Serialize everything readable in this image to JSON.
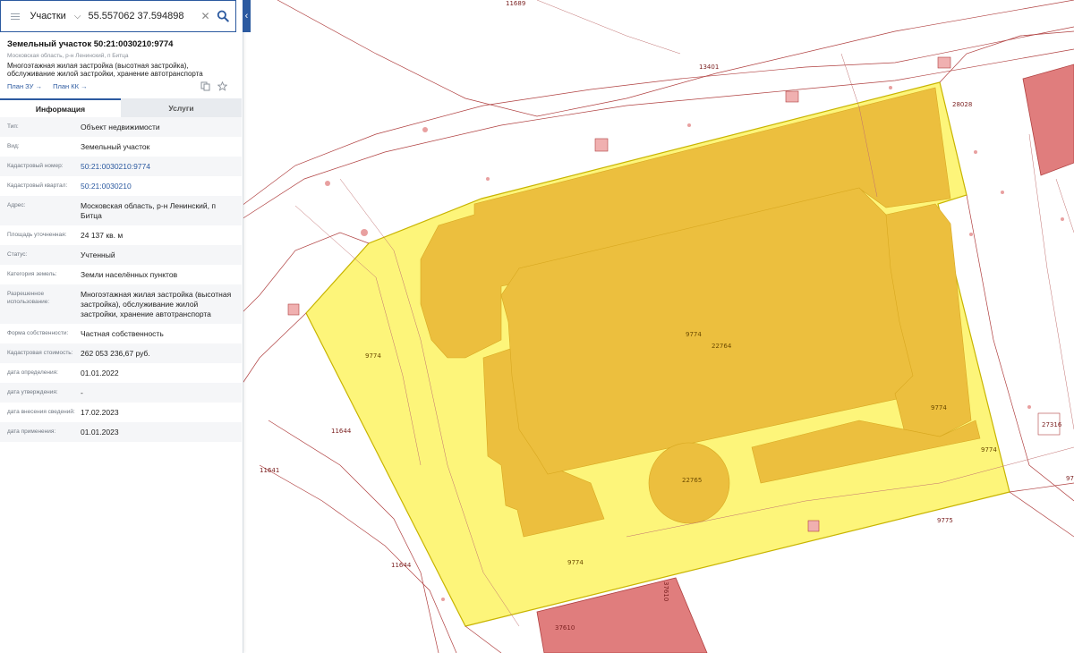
{
  "search": {
    "layer": "Участки",
    "value": "55.557062 37.594898"
  },
  "parcel": {
    "title": "Земельный участок 50:21:0030210:9774",
    "address_short": "Московская область, р-н Ленинский, п Битца",
    "description": "Многоэтажная жилая застройка (высотная застройка), обслуживание жилой застройки, хранение автотранспорта",
    "links": [
      "План ЗУ →",
      "План КК →"
    ]
  },
  "tabs": [
    "Информация",
    "Услуги"
  ],
  "rows": [
    {
      "label": "Тип:",
      "value": "Объект недвижимости"
    },
    {
      "label": "Вид:",
      "value": "Земельный участок"
    },
    {
      "label": "Кадастровый номер:",
      "value": "50:21:0030210:9774"
    },
    {
      "label": "Кадастровый квартал:",
      "value": "50:21:0030210"
    },
    {
      "label": "Адрес:",
      "value": "Московская область, р-н Ленинский, п Битца"
    },
    {
      "label": "Площадь уточненная:",
      "value": "24 137 кв. м"
    },
    {
      "label": "Статус:",
      "value": "Учтенный"
    },
    {
      "label": "Категория земель:",
      "value": "Земли населённых пунктов"
    },
    {
      "label": "Разрешенное использование:",
      "value": "Многоэтажная жилая застройка (высотная застройка), обслуживание жилой застройки, хранение автотранспорта"
    },
    {
      "label": "Форма собственности:",
      "value": "Частная собственность"
    },
    {
      "label": "Кадастровая стоимость:",
      "value": "262 053 236,67 руб."
    },
    {
      "label": "дата определения:",
      "value": "01.01.2022"
    },
    {
      "label": "дата утверждения:",
      "value": "-"
    },
    {
      "label": "дата внесения сведений:",
      "value": "17.02.2023"
    },
    {
      "label": "дата применения:",
      "value": "01.01.2023"
    }
  ],
  "map_labels": {
    "l11689": "11689",
    "l13401": "13401",
    "l28028": "28028",
    "l9774a": "9774",
    "l9774b": "9774",
    "l9774c": "9774",
    "l9774d": "9774",
    "l9774e": "9774",
    "l11644a": "11644",
    "l11644b": "11644",
    "l11641": "11641",
    "l9775": "9775",
    "l97": "97",
    "l27316": "27316",
    "l37610a": "37610",
    "l37610b": "37610",
    "l22764": "22764",
    "l22765": "22765"
  },
  "colors": {
    "parcel_fill": "#fdf57a",
    "parcel_stroke": "#c8b400",
    "building_fill": "#ecbf3e",
    "pink_fill": "#e07d7d",
    "line_red": "#b04040",
    "accent": "#2c5aa0"
  },
  "icons": [
    "menu-icon",
    "chevron-down-icon",
    "clear-icon",
    "search-icon",
    "collapse-left-icon",
    "copy-icon",
    "star-icon"
  ]
}
